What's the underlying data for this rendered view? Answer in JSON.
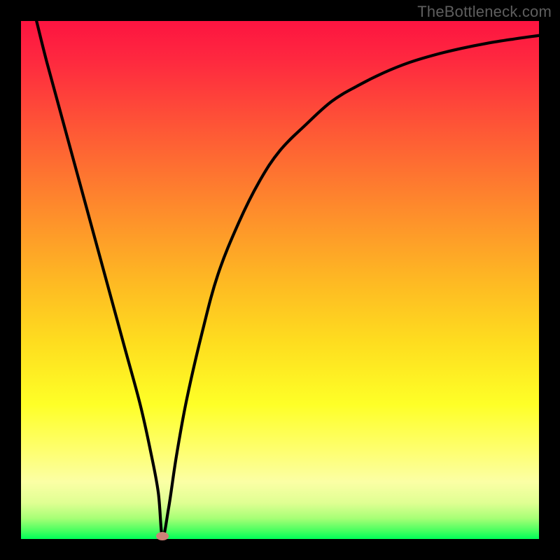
{
  "watermark": "TheBottleneck.com",
  "colors": {
    "frame": "#000000",
    "top": "#fd1441",
    "mid_upper": "#fe7e2f",
    "mid": "#fddd20",
    "mid_lower": "#feff66",
    "lower": "#e5ff84",
    "bottom": "#00ff58",
    "curve": "#000000",
    "marker": "#cf8277"
  },
  "chart_data": {
    "type": "line",
    "title": "",
    "xlabel": "",
    "ylabel": "",
    "xlim": [
      0,
      100
    ],
    "ylim": [
      0,
      100
    ],
    "x": [
      3,
      5,
      8,
      11,
      14,
      17,
      20,
      23,
      25,
      26.5,
      27.3,
      28.5,
      30,
      32,
      35,
      38,
      42,
      46,
      50,
      55,
      60,
      65,
      70,
      75,
      80,
      85,
      90,
      95,
      100
    ],
    "values": [
      100,
      92,
      81,
      70,
      59,
      48,
      37,
      26,
      17,
      9,
      0.5,
      6,
      16,
      27,
      40,
      51,
      61,
      69,
      75,
      80,
      84.5,
      87.5,
      90,
      92,
      93.5,
      94.7,
      95.7,
      96.5,
      97.2
    ],
    "marker": {
      "x": 27.3,
      "y": 0.5
    },
    "note": "x and y are in 0–100 domain units mapped linearly to the plot area; values estimated from pixel heights on a vertical red→green gradient."
  }
}
